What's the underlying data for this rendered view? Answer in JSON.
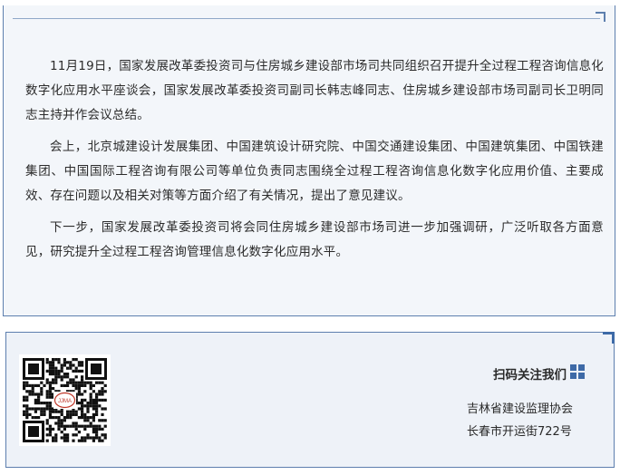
{
  "article": {
    "paragraphs": [
      "11月19日，国家发展改革委投资司与住房城乡建设部市场司共同组织召开提升全过程工程咨询信息化数字化应用水平座谈会，国家发展改革委投资司副司长韩志峰同志、住房城乡建设部市场司副司长卫明同志主持并作会议总结。",
      "会上，北京城建设计发展集团、中国建筑设计研究院、中国交通建设集团、中国建筑集团、中国铁建集团、中国国际工程咨询有限公司等单位负责同志围绕全过程工程咨询信息化数字化应用价值、主要成效、存在问题以及相关对策等方面介绍了有关情况，提出了意见建议。",
      "下一步，国家发展改革委投资司将会同住房城乡建设部市场司进一步加强调研，广泛听取各方面意见，研究提升全过程工程咨询管理信息化数字化应用水平。"
    ]
  },
  "footer": {
    "scan_title": "扫码关注我们",
    "org_name": "吉林省建设监理协会",
    "address": "长春市开运街722号",
    "qr_logo_text": "JJMA",
    "icons": {
      "qr": "qr-code-icon",
      "grid": "grid-icon"
    }
  },
  "colors": {
    "accent": "#3e6aa7",
    "border": "#5d7fae",
    "panel_bg": "#f3f6fa"
  }
}
